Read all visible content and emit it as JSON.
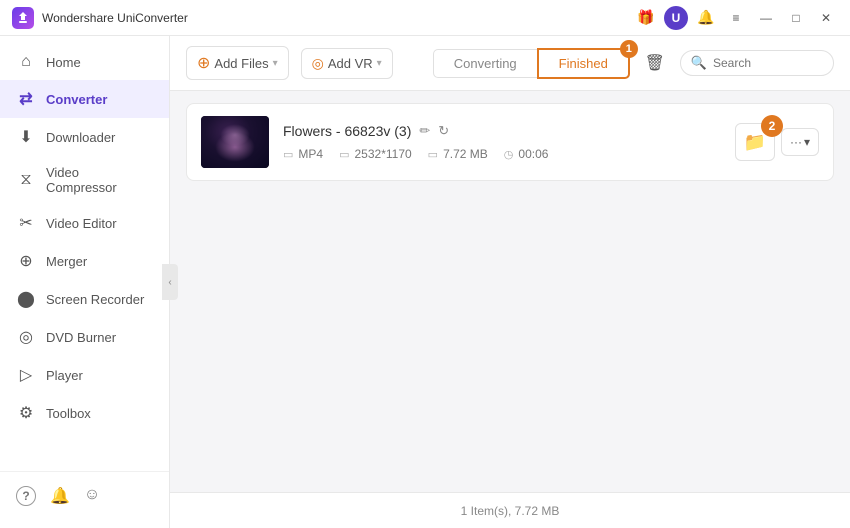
{
  "app": {
    "title": "Wondershare UniConverter",
    "logo_alt": "WU Logo"
  },
  "titlebar": {
    "icons": {
      "gift": "🎁",
      "user": "U",
      "bell": "🔔",
      "menu": "≡",
      "minimize": "—",
      "maximize": "□",
      "close": "✕"
    }
  },
  "sidebar": {
    "items": [
      {
        "id": "home",
        "label": "Home",
        "icon": "⌂"
      },
      {
        "id": "converter",
        "label": "Converter",
        "icon": "⇄",
        "active": true
      },
      {
        "id": "downloader",
        "label": "Downloader",
        "icon": "⬇"
      },
      {
        "id": "video-compressor",
        "label": "Video Compressor",
        "icon": "⧖"
      },
      {
        "id": "video-editor",
        "label": "Video Editor",
        "icon": "✂"
      },
      {
        "id": "merger",
        "label": "Merger",
        "icon": "⊕"
      },
      {
        "id": "screen-recorder",
        "label": "Screen Recorder",
        "icon": "⬤"
      },
      {
        "id": "dvd-burner",
        "label": "DVD Burner",
        "icon": "◎"
      },
      {
        "id": "player",
        "label": "Player",
        "icon": "▷"
      },
      {
        "id": "toolbox",
        "label": "Toolbox",
        "icon": "⚙"
      }
    ],
    "bottom_items": [
      {
        "id": "help",
        "icon": "?"
      },
      {
        "id": "notification",
        "icon": "🔔"
      },
      {
        "id": "feedback",
        "icon": "☺"
      }
    ]
  },
  "toolbar": {
    "add_files_label": "Add Files",
    "add_files_dropdown": "▾",
    "add_vr_label": "Add VR",
    "add_vr_dropdown": "▾",
    "tabs": [
      {
        "id": "converting",
        "label": "Converting",
        "active": false
      },
      {
        "id": "finished",
        "label": "Finished",
        "active": true,
        "badge": "1"
      }
    ],
    "clear_icon": "🗑",
    "search_placeholder": "Search"
  },
  "file_item": {
    "name": "Flowers - 66823v (3)",
    "edit_icon": "✏",
    "refresh_icon": "↻",
    "format": "MP4",
    "resolution": "2532*1170",
    "size": "7.72 MB",
    "duration": "00:06",
    "folder_btn_icon": "📁",
    "badge_num": "2",
    "more_icon": "···",
    "more_dropdown": "▾"
  },
  "statusbar": {
    "text": "1 Item(s), 7.72 MB"
  }
}
